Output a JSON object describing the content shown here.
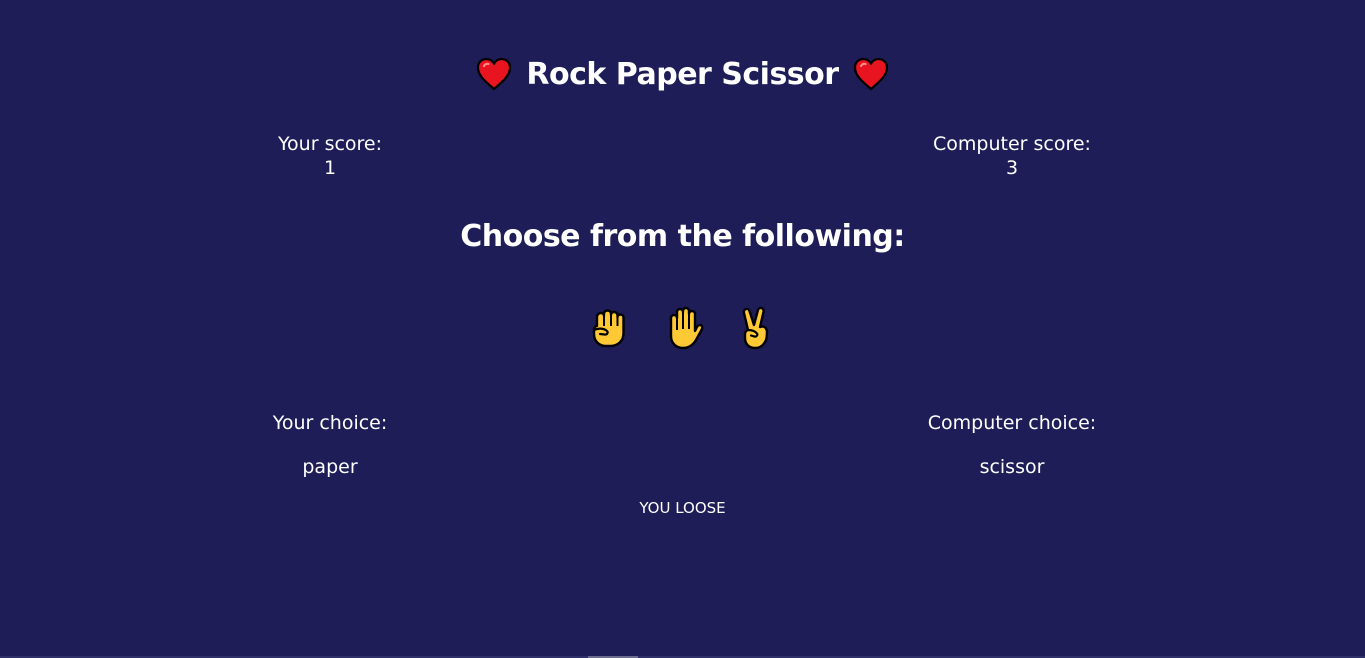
{
  "header": {
    "title": "Rock Paper Scissor",
    "left_icon": "heart-icon",
    "right_icon": "heart-icon"
  },
  "scores": {
    "player_label": "Your score:",
    "player_value": "1",
    "computer_label": "Computer score:",
    "computer_value": "3"
  },
  "choose_heading": "Choose from the following:",
  "choices": [
    {
      "name": "rock",
      "icon": "raised-fist-icon"
    },
    {
      "name": "paper",
      "icon": "raised-hand-icon"
    },
    {
      "name": "scissor",
      "icon": "victory-hand-icon"
    }
  ],
  "picks": {
    "player_label": "Your choice:",
    "player_value": "paper",
    "computer_label": "Computer choice:",
    "computer_value": "scissor"
  },
  "result": "YOU LOOSE",
  "colors": {
    "background": "#1e1d57",
    "text": "#ffffff",
    "heart": "#e8141f",
    "hand": "#ffc935"
  }
}
